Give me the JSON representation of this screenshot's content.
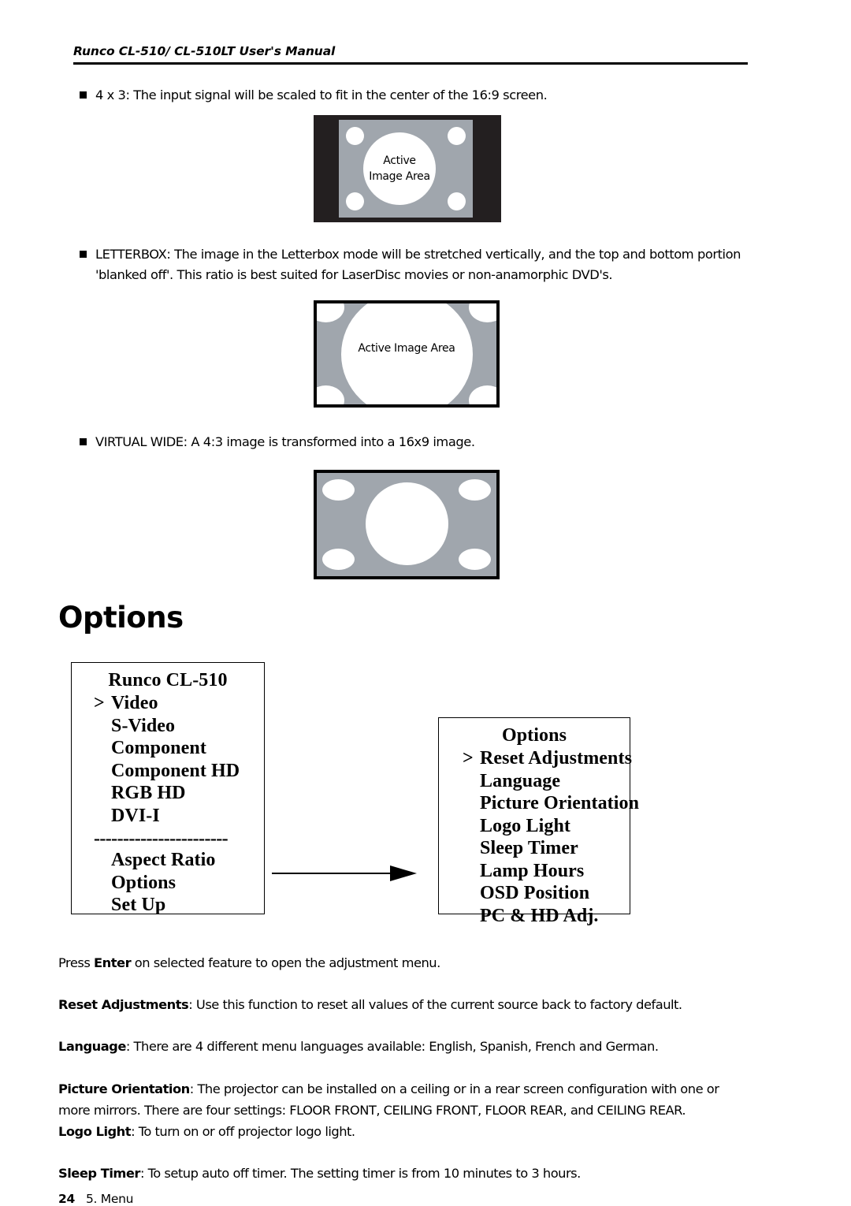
{
  "header": {
    "title": "Runco CL-510/ CL-510LT User's Manual"
  },
  "bullets": [
    {
      "id": "4x3",
      "text": "4 x 3:  The input signal will be scaled to fit in the center of the 16:9 screen."
    },
    {
      "id": "letterbox",
      "text": "LETTERBOX: The image in the Letterbox mode will be stretched vertically, and the top and bottom portion 'blanked off'. This ratio is best suited for LaserDisc movies or non-anamorphic DVD's."
    },
    {
      "id": "virtual-wide",
      "text": "VIRTUAL WIDE: A 4:3 image is transformed into a 16x9 image."
    }
  ],
  "diagrams": [
    {
      "id": "4x3",
      "label": "Active\nImage Area",
      "frame_color": "#231f20",
      "panel_color": "#a0a6ad",
      "image_color": "#ffffff"
    },
    {
      "id": "letterbox",
      "label": "Active Image Area",
      "frame_color": "#000000",
      "panel_color": "#a0a6ad",
      "image_color": "#ffffff"
    },
    {
      "id": "virtual-wide",
      "label": "",
      "frame_color": "#000000",
      "panel_color": "#a0a6ad",
      "image_color": "#ffffff"
    }
  ],
  "section": {
    "heading": "Options"
  },
  "menu_main": {
    "title": "Runco CL-510",
    "caret": ">",
    "separator": "-----------------------",
    "items_before": [
      {
        "caret": ">",
        "label": "Video"
      },
      {
        "caret": "",
        "label": "S-Video"
      },
      {
        "caret": "",
        "label": "Component"
      },
      {
        "caret": "",
        "label": "Component HD"
      },
      {
        "caret": "",
        "label": "RGB HD"
      },
      {
        "caret": "",
        "label": "DVI-I"
      }
    ],
    "items_after": [
      {
        "caret": "",
        "label": "Aspect Ratio"
      },
      {
        "caret": "",
        "label": "Options"
      },
      {
        "caret": "",
        "label": "Set Up"
      }
    ]
  },
  "menu_options": {
    "title": "Options",
    "items": [
      {
        "caret": ">",
        "label": "Reset Adjustments"
      },
      {
        "caret": "",
        "label": "Language"
      },
      {
        "caret": "",
        "label": "Picture Orientation"
      },
      {
        "caret": "",
        "label": "Logo Light"
      },
      {
        "caret": "",
        "label": "Sleep Timer"
      },
      {
        "caret": "",
        "label": "Lamp Hours"
      },
      {
        "caret": "",
        "label": "OSD Position"
      },
      {
        "caret": "",
        "label": "PC & HD Adj."
      }
    ]
  },
  "descriptions": [
    {
      "id": "enter",
      "lead": "",
      "pre": "Press ",
      "bold": "Enter",
      "post": " on selected feature to open the adjustment menu."
    },
    {
      "id": "reset",
      "lead": "Reset Adjustments",
      "post": ": Use this function to reset all values of the current source back to factory default."
    },
    {
      "id": "language",
      "lead": "Language",
      "post": ": There are 4 different menu languages available: English, Spanish, French and German."
    },
    {
      "id": "picture",
      "lead": "Picture Orientation",
      "post": ": The projector can be installed on a ceiling or in a rear screen configuration with one or more mirrors. There are four settings: FLOOR FRONT, CEILING FRONT, FLOOR REAR, and CEILING REAR."
    },
    {
      "id": "logolight",
      "lead": "Logo Light",
      "post": ": To turn on or off projector logo light."
    },
    {
      "id": "sleep",
      "lead": "Sleep Timer",
      "post": ": To setup auto off timer. The setting timer is from 10 minutes to 3 hours."
    }
  ],
  "footer": {
    "page_number": "24",
    "section_label": "5. Menu"
  }
}
